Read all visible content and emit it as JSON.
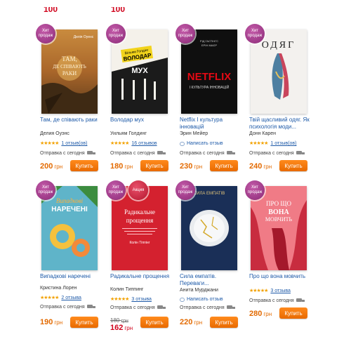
{
  "currency": "грн",
  "buy_label": "Купить",
  "shipping_label": "Отправка с сегодня",
  "write_review_label": "Написать отзыв",
  "stars": "★★★★★",
  "accent_color": "#e36a00",
  "badges": {
    "hit": "Хит продаж",
    "sale": "Акция"
  },
  "books": [
    {
      "title": "Там, де співають раки",
      "author": "Делия Оуэнс",
      "cover_title": "ТАМ, ДЕ СПІВАЮТЬ РАКИ",
      "cover_author": "Делія Оуенс",
      "rating": "★★★★★",
      "reviews": "1 отзыв(ов)",
      "price": "200",
      "badge": "hit"
    },
    {
      "title": "Володар мух",
      "author": "Уильям Голдинг",
      "cover_title": "ВОЛОДАР МУХ",
      "cover_author": "Вільям Голдінг",
      "rating": "★★★★★",
      "reviews": "16 отзывов",
      "price": "180",
      "badge": "hit"
    },
    {
      "title": "Netflix І культура інновацій",
      "author": "Эрин Мейер",
      "cover_title": "NETFLIX",
      "cover_subtitle": "І КУЛЬТУРА ІННОВАЦІЙ",
      "cover_author": "РІД ГАСТІНГС ЕРІН МАЄР",
      "write_review": true,
      "price": "230",
      "badge": "hit"
    },
    {
      "title": "Твій щасливий одяг. Як психологія моди...",
      "author": "Донн Карен",
      "cover_title": "ОДЯГ",
      "rating": "★★★★★",
      "reviews": "1 отзыв(ов)",
      "price": "240",
      "badge": "hit"
    },
    {
      "title": "Випадкові наречені",
      "author": "Кристина Лорен",
      "cover_title": "Випадкові НАРЕЧЕНІ",
      "cover_author": "Крістіна Лорен",
      "rating": "★★★★★",
      "reviews": "2 отзыва",
      "price": "190",
      "badge": "hit"
    },
    {
      "title": "Радикальне прощення",
      "author": "Колин Типпинг",
      "cover_title": "Радикальне прощення",
      "cover_author": "Колін Тіппінг",
      "rating": "★★★★★",
      "reviews": "3 отзыва",
      "old_price": "180",
      "price": "162",
      "badge": "hit",
      "badge2": "sale"
    },
    {
      "title": "Сила емпатів. Переваги...",
      "author": "Анита Мурджани",
      "cover_title": "СИЛА ЕМПАТІВ",
      "write_review": true,
      "price": "220",
      "badge": "hit"
    },
    {
      "title": "Про що вона мовчить",
      "author": "",
      "cover_title": "ПРО ЩО ВОНА МОВЧИТЬ",
      "rating": "★★★★★",
      "reviews": "3 отзыва",
      "price": "280",
      "badge": "hit"
    }
  ]
}
